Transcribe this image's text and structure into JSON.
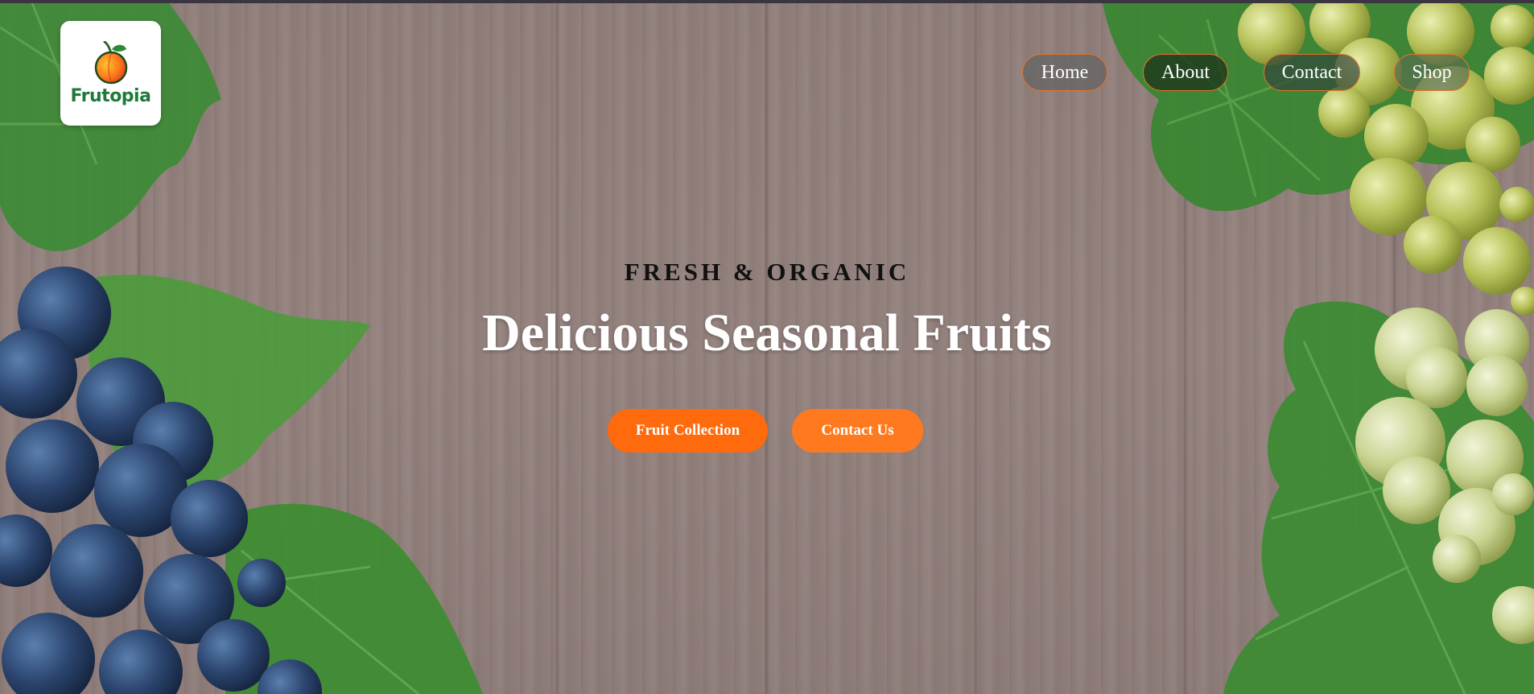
{
  "brand": {
    "name": "Frutopia",
    "logo_icon": "peach-icon"
  },
  "nav": {
    "items": [
      {
        "label": "Home"
      },
      {
        "label": "About"
      },
      {
        "label": "Contact"
      },
      {
        "label": "Shop"
      }
    ]
  },
  "hero": {
    "eyebrow": "FRESH & ORGANIC",
    "title": "Delicious Seasonal Fruits",
    "buttons": [
      {
        "label": "Fruit Collection"
      },
      {
        "label": "Contact Us"
      }
    ]
  },
  "colors": {
    "accent": "#ff6a0c",
    "nav_border": "#e0742a",
    "brand_green": "#1f7a3a",
    "wood": "#a08e87"
  }
}
